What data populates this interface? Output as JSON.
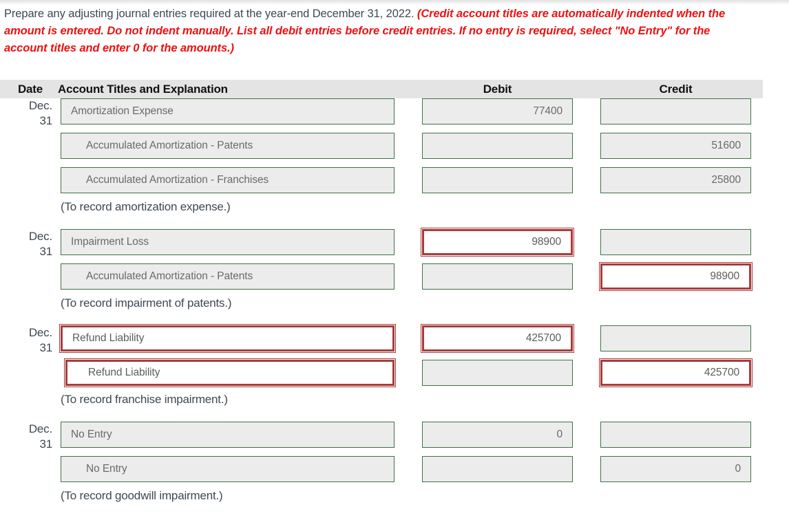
{
  "instructions": {
    "normal_text": "Prepare any adjusting journal entries required at the year-end December 31, 2022. ",
    "warning_text": "(Credit account titles are automatically indented when the amount is entered. Do not indent manually. List all debit entries before credit entries. If no entry is required, select \"No Entry\" for the account titles and enter 0 for the amounts.)",
    "warning_color": "#ee1111"
  },
  "table": {
    "headers": {
      "date": "Date",
      "account": "Account Titles and Explanation",
      "debit": "Debit",
      "credit": "Credit"
    },
    "colors": {
      "header_bg": "#e4e4e4",
      "field_border_ok": "#3f7144",
      "field_border_error": "#a93b3b",
      "field_bg": "#ececec"
    },
    "blocks": [
      {
        "date_line1": "Dec.",
        "date_line2": "31",
        "rows": [
          {
            "account": "Amortization Expense",
            "indent": false,
            "account_state": "ok",
            "debit": "77400",
            "debit_state": "ok",
            "credit": "",
            "credit_state": "ok"
          },
          {
            "account": "Accumulated Amortization - Patents",
            "indent": true,
            "account_state": "ok",
            "debit": "",
            "debit_state": "ok",
            "credit": "51600",
            "credit_state": "ok"
          },
          {
            "account": "Accumulated Amortization - Franchises",
            "indent": true,
            "account_state": "ok",
            "debit": "",
            "debit_state": "ok",
            "credit": "25800",
            "credit_state": "ok"
          }
        ],
        "memo": "(To record amortization expense.)"
      },
      {
        "date_line1": "Dec.",
        "date_line2": "31",
        "rows": [
          {
            "account": "Impairment Loss",
            "indent": false,
            "account_state": "ok",
            "debit": "98900",
            "debit_state": "error",
            "credit": "",
            "credit_state": "ok"
          },
          {
            "account": "Accumulated Amortization - Patents",
            "indent": true,
            "account_state": "ok",
            "debit": "",
            "debit_state": "ok",
            "credit": "98900",
            "credit_state": "error"
          }
        ],
        "memo": "(To record impairment of patents.)"
      },
      {
        "date_line1": "Dec.",
        "date_line2": "31",
        "rows": [
          {
            "account": "Refund Liability",
            "indent": false,
            "account_state": "error",
            "debit": "425700",
            "debit_state": "error",
            "credit": "",
            "credit_state": "ok"
          },
          {
            "account": "Refund Liability",
            "indent": true,
            "account_state": "error",
            "debit": "",
            "debit_state": "ok",
            "credit": "425700",
            "credit_state": "error"
          }
        ],
        "memo": "(To record franchise impairment.)"
      },
      {
        "date_line1": "Dec.",
        "date_line2": "31",
        "rows": [
          {
            "account": "No Entry",
            "indent": false,
            "account_state": "ok",
            "debit": "0",
            "debit_state": "ok",
            "credit": "",
            "credit_state": "ok"
          },
          {
            "account": "No Entry",
            "indent": true,
            "account_state": "ok",
            "debit": "",
            "debit_state": "ok",
            "credit": "0",
            "credit_state": "ok"
          }
        ],
        "memo": "(To record goodwill impairment.)"
      }
    ]
  }
}
